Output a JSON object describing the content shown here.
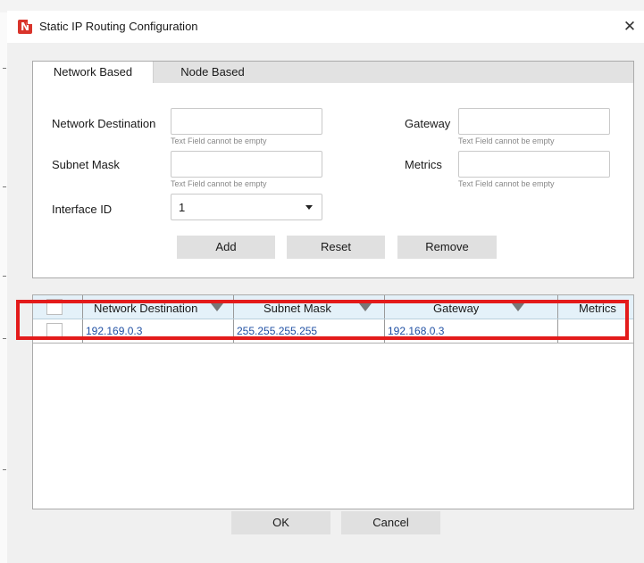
{
  "dialog": {
    "title": "Static IP Routing Configuration",
    "close_glyph": "✕",
    "app_icon_letter": "N"
  },
  "tabs": [
    {
      "label": "Network Based",
      "active": true
    },
    {
      "label": "Node Based",
      "active": false
    }
  ],
  "form": {
    "network_destination_label": "Network Destination",
    "network_destination_value": "",
    "network_destination_hint": "Text Field cannot be empty",
    "gateway_label": "Gateway",
    "gateway_value": "",
    "gateway_hint": "Text Field cannot be empty",
    "subnet_mask_label": "Subnet Mask",
    "subnet_mask_value": "",
    "subnet_mask_hint": "Text Field cannot be empty",
    "metrics_label": "Metrics",
    "metrics_value": "",
    "metrics_hint": "Text Field cannot be empty",
    "interface_id_label": "Interface ID",
    "interface_id_value": "1"
  },
  "actions": {
    "add": "Add",
    "reset": "Reset",
    "remove": "Remove"
  },
  "table": {
    "columns": [
      "Network Destination",
      "Subnet Mask",
      "Gateway",
      "Metrics"
    ],
    "rows": [
      {
        "network_destination": "192.169.0.3",
        "subnet_mask": "255.255.255.255",
        "gateway": "192.168.0.3",
        "metrics": ""
      }
    ]
  },
  "footer": {
    "ok": "OK",
    "cancel": "Cancel"
  },
  "colors": {
    "highlight": "#e31b1b",
    "cell_text": "#1f4fa3",
    "header_bg": "#e4f1f9",
    "app_icon": "#d9342b"
  }
}
